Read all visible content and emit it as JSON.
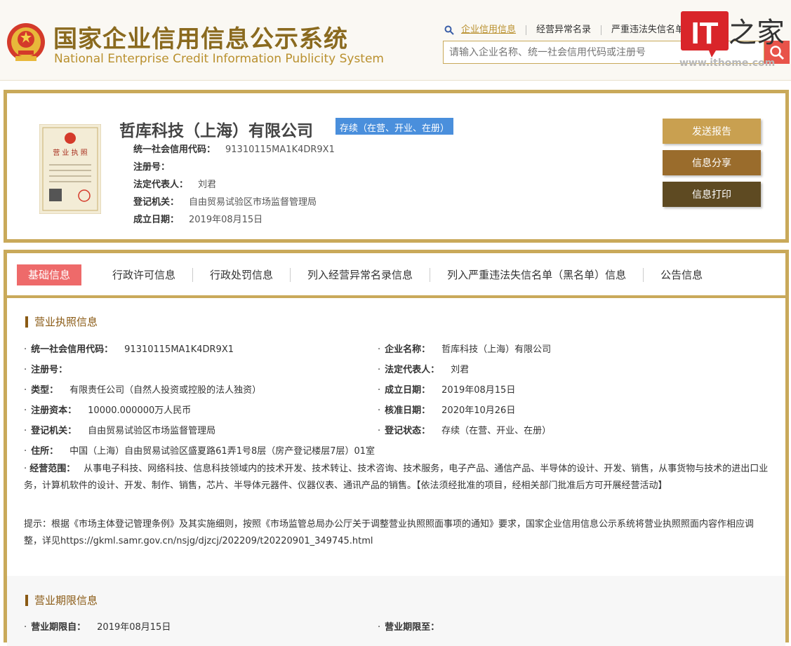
{
  "header": {
    "title_cn": "国家企业信用信息公示系统",
    "title_en": "National Enterprise Credit Information Publicity System",
    "search_tabs": [
      "企业信用信息",
      "经营异常名录",
      "严重违法失信名单"
    ],
    "search_placeholder": "请输入企业名称、统一社会信用代码或注册号",
    "watermark": "www.ithome.com"
  },
  "company": {
    "name": "哲库科技（上海）有限公司",
    "status": "存续（在营、开业、在册）",
    "info": [
      {
        "label": "统一社会信用代码：",
        "value": "91310115MA1K4DR9X1"
      },
      {
        "label": "注册号：",
        "value": ""
      },
      {
        "label": "法定代表人：",
        "value": "刘君"
      },
      {
        "label": "登记机关：",
        "value": "自由贸易试验区市场监督管理局"
      },
      {
        "label": "成立日期：",
        "value": "2019年08月15日"
      }
    ],
    "buttons": {
      "report": "发送报告",
      "share": "信息分享",
      "print": "信息打印"
    }
  },
  "tabs": [
    "基础信息",
    "行政许可信息",
    "行政处罚信息",
    "列入经营异常名录信息",
    "列入严重违法失信名单（黑名单）信息",
    "公告信息"
  ],
  "license_section": {
    "title": "营业执照信息",
    "left": [
      {
        "label": "统一社会信用代码：",
        "value": "91310115MA1K4DR9X1"
      },
      {
        "label": "注册号：",
        "value": ""
      },
      {
        "label": "类型：",
        "value": "有限责任公司（自然人投资或控股的法人独资）"
      },
      {
        "label": "注册资本：",
        "value": "10000.000000万人民币"
      },
      {
        "label": "登记机关：",
        "value": "自由贸易试验区市场监督管理局"
      }
    ],
    "right": [
      {
        "label": "企业名称：",
        "value": "哲库科技（上海）有限公司"
      },
      {
        "label": "法定代表人：",
        "value": "刘君"
      },
      {
        "label": "成立日期：",
        "value": "2019年08月15日"
      },
      {
        "label": "核准日期：",
        "value": "2020年10月26日"
      },
      {
        "label": "登记状态：",
        "value": "存续（在营、开业、在册）"
      }
    ],
    "address_label": "住所：",
    "address": "中国（上海）自由贸易试验区盛夏路61弄1号8层（房产登记楼层7层）01室",
    "scope_label": "经营范围：",
    "scope": "从事电子科技、网络科技、信息科技领域内的技术开发、技术转让、技术咨询、技术服务，电子产品、通信产品、半导体的设计、开发、销售，从事货物与技术的进出口业务，计算机软件的设计、开发、制作、销售，芯片、半导体元器件、仪器仪表、通讯产品的销售。【依法须经批准的项目，经相关部门批准后方可开展经营活动】",
    "notice": "提示：根据《市场主体登记管理条例》及其实施细则，按照《市场监管总局办公厅关于调整营业执照照面事项的通知》要求，国家企业信用信息公示系统将营业执照照面内容作相应调整，详见https://gkml.samr.gov.cn/nsjg/djzcj/202209/t20220901_349745.html"
  },
  "period_section": {
    "title": "营业期限信息",
    "from_label": "营业期限自：",
    "from": "2019年08月15日",
    "to_label": "营业期限至：",
    "to": ""
  }
}
